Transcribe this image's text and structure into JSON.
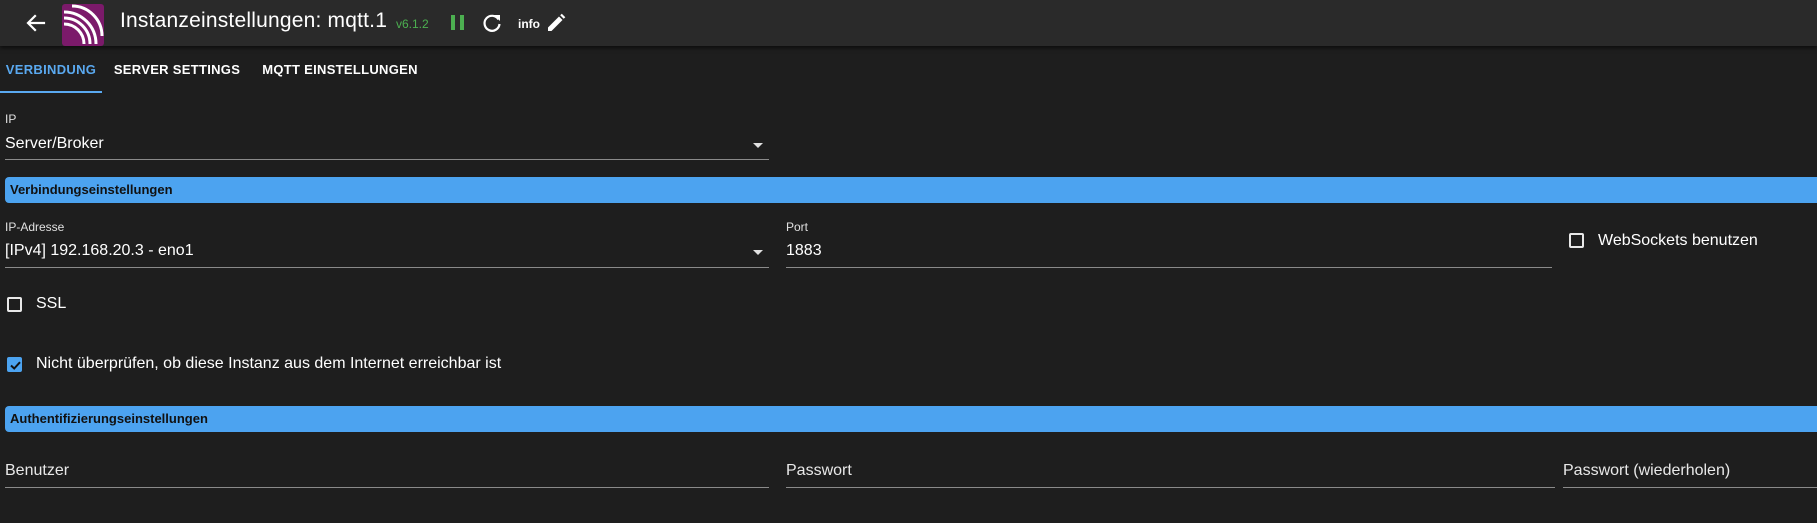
{
  "header": {
    "title": "Instanzeinstellungen: mqtt.1",
    "version": "v6.1.2",
    "info_label": "info"
  },
  "tabs": [
    {
      "label": "VERBINDUNG",
      "active": true
    },
    {
      "label": "SERVER SETTINGS",
      "active": false
    },
    {
      "label": "MQTT EINSTELLUNGEN",
      "active": false
    }
  ],
  "ip_type": {
    "label": "IP",
    "value": "Server/Broker"
  },
  "sections": {
    "connection": "Verbindungseinstellungen",
    "auth": "Authentifizierungseinstellungen"
  },
  "connection": {
    "ip_label": "IP-Adresse",
    "ip_value": "[IPv4] 192.168.20.3 - eno1",
    "port_label": "Port",
    "port_value": "1883",
    "websockets_label": "WebSockets benutzen",
    "websockets_checked": false,
    "ssl_label": "SSL",
    "ssl_checked": false,
    "no_check_label": "Nicht überprüfen, ob diese Instanz aus dem Internet erreichbar ist",
    "no_check_checked": true
  },
  "auth": {
    "user_placeholder": "Benutzer",
    "password_placeholder": "Passwort",
    "password_repeat_placeholder": "Passwort (wiederholen)"
  },
  "colors": {
    "accent": "#4ca3f0",
    "version_green": "#4caf50",
    "background": "#1e1e1e",
    "topbar": "#2a2a2a",
    "logo_purple": "#7b1a6a"
  },
  "icons": [
    "arrow-back-icon",
    "mqtt-logo-icon",
    "pause-icon",
    "reload-icon",
    "edit-pencil-icon",
    "dropdown-arrow-icon",
    "checkbox-icon",
    "check-icon"
  ]
}
